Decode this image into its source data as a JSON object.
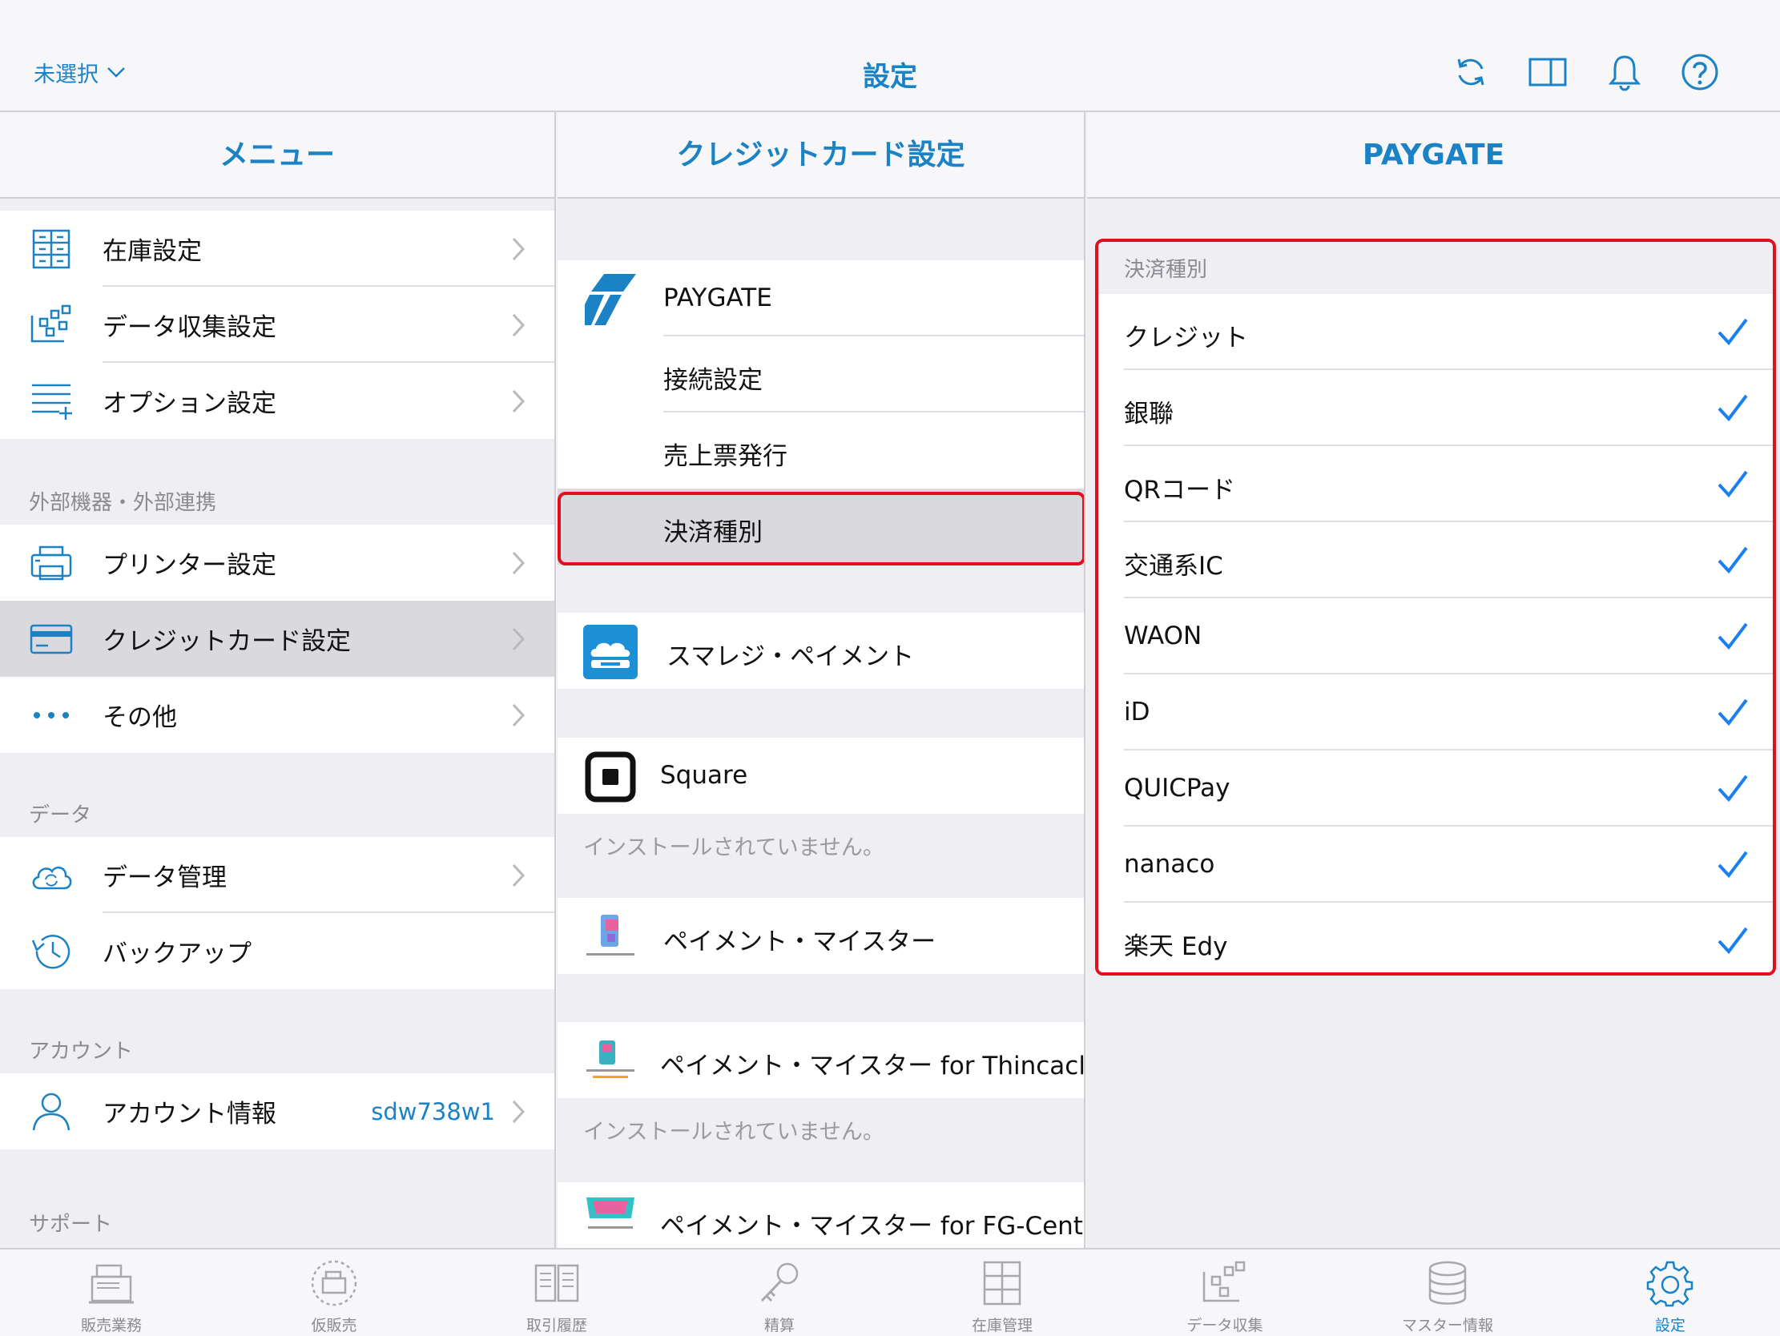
{
  "topbar": {
    "store_selector": "未選択",
    "title": "設定"
  },
  "columns": {
    "menu_title": "メニュー",
    "card_title": "クレジットカード設定",
    "paygate_title": "PAYGATE"
  },
  "menu": {
    "items_top": [
      {
        "label": "在庫設定"
      },
      {
        "label": "データ収集設定"
      },
      {
        "label": "オプション設定"
      }
    ],
    "section_external": "外部機器・外部連携",
    "items_external": [
      {
        "label": "プリンター設定"
      },
      {
        "label": "クレジットカード設定"
      },
      {
        "label": "その他"
      }
    ],
    "section_data": "データ",
    "items_data": [
      {
        "label": "データ管理"
      },
      {
        "label": "バックアップ"
      }
    ],
    "section_account": "アカウント",
    "account": {
      "label": "アカウント情報",
      "value": "sdw738w1"
    },
    "section_support": "サポート"
  },
  "card": {
    "paygate": {
      "name": "PAYGATE",
      "sub_items": [
        "接続設定",
        "売上票発行",
        "決済種別"
      ]
    },
    "smaregi": "スマレジ・ペイメント",
    "square": "Square",
    "not_installed": "インストールされていません。",
    "pm": "ペイメント・マイスター",
    "pm_thincacloud": "ペイメント・マイスター for Thincacloud",
    "pm_fg": "ペイメント・マイスター for FG-Center"
  },
  "paygate": {
    "section": "決済種別",
    "items": [
      {
        "label": "クレジット",
        "checked": true
      },
      {
        "label": "銀聯",
        "checked": true
      },
      {
        "label": "QRコード",
        "checked": true
      },
      {
        "label": "交通系IC",
        "checked": true
      },
      {
        "label": "WAON",
        "checked": true
      },
      {
        "label": "iD",
        "checked": true
      },
      {
        "label": "QUICPay",
        "checked": true
      },
      {
        "label": "nanaco",
        "checked": true
      },
      {
        "label": "楽天 Edy",
        "checked": true
      }
    ]
  },
  "tabbar": {
    "tabs": [
      {
        "label": "販売業務"
      },
      {
        "label": "仮販売"
      },
      {
        "label": "取引履歴"
      },
      {
        "label": "精算"
      },
      {
        "label": "在庫管理"
      },
      {
        "label": "データ収集"
      },
      {
        "label": "マスター情報"
      },
      {
        "label": "設定",
        "active": true
      }
    ]
  },
  "colors": {
    "accent": "#1b82c5",
    "highlight": "#e01020",
    "check": "#1a7ff0"
  }
}
